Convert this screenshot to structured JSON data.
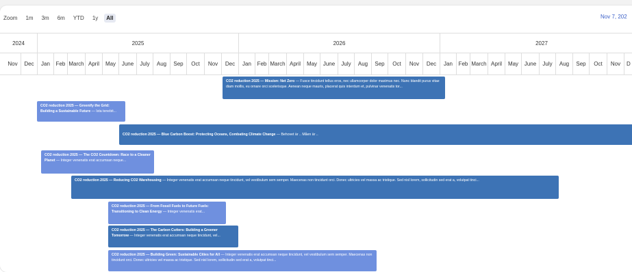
{
  "toolbar": {
    "zoom_label": "Zoom",
    "zoom_options": [
      "1m",
      "3m",
      "6m",
      "YTD",
      "1y",
      "All"
    ],
    "active": "All",
    "date_text": "Nov 7, 202"
  },
  "timeline": {
    "years": [
      "2024",
      "2025",
      "2026",
      "2027"
    ],
    "months": [
      "Nov",
      "Dec",
      "Jan",
      "Feb",
      "March",
      "April",
      "May",
      "June",
      "July",
      "Aug",
      "Sep",
      "Oct",
      "Nov",
      "Dec",
      "Jan",
      "Feb",
      "March",
      "April",
      "May",
      "June",
      "July",
      "Aug",
      "Sep",
      "Oct",
      "Nov",
      "Dec",
      "Jan",
      "Feb",
      "March",
      "April",
      "May",
      "June",
      "July",
      "Aug",
      "Sep",
      "Oct",
      "Nov",
      "D"
    ]
  },
  "tasks": [
    {
      "title": "CO2 reduction 2025 — Mission: Net Zero",
      "desc": " — Fusce tincidunt tellus eros, nec ullamcorper dolor maximus nec. Nunc blandit purus vitae diam mollis, eu ornare orci scelerisque. Aenean neque mauris, placerat quis interdum et, pulvinar venenatis tor..."
    },
    {
      "title": "CO2 reduction 2025 — Greenify the Grid: Building a Sustainable Future",
      "desc": " — Ista tenebit..."
    },
    {
      "title": "CO2 reduction 2025 — Blue Carbon Boost: Protecting Oceans, Combating Climate Change",
      "desc": " — Behovet är .. Måen är .."
    },
    {
      "title": "CO2 reduction 2025 — The CO2 Countdown: Race to a Cleaner Planet",
      "desc": " — Integer venenatis erat accumsan neque..."
    },
    {
      "title": "CO2 reduction 2025 — Reducing CO2 Warehousing",
      "desc": " — Integer venenatis erat accumsan neque tincidunt, vel vestibulum sem semper. Maecenas non tincidunt orci. Donec ultricies vel massa ac tristique. Sed nisl lorem, sollicitudin sed erat a, volutpat tinci..."
    },
    {
      "title": "CO2 reduction 2025 — From Fossil Fuels to Future Fuels: Transitioning to Clean Energy",
      "desc": " — Integer venenatis erat..."
    },
    {
      "title": "CO2 reduction 2025 — The Carbon Cutters: Building a Greener Tomorrow",
      "desc": " — Integer venenatis erat accumsan neque tincidunt, vel..."
    },
    {
      "title": "CO2 reduction 2025 — Building Green: Sustainable Cities for All",
      "desc": " — Integer venenatis erat accumsan neque tincidunt, vel vestibulum sem semper. Maecenas non tincidunt orci. Donec ultricies vel massa ac tristique. Sed nisl lorem, sollicitudin sed erat a, volutpat tinci..."
    }
  ],
  "colors": {
    "dark": "#3d73b5",
    "light": "#6f90df"
  }
}
